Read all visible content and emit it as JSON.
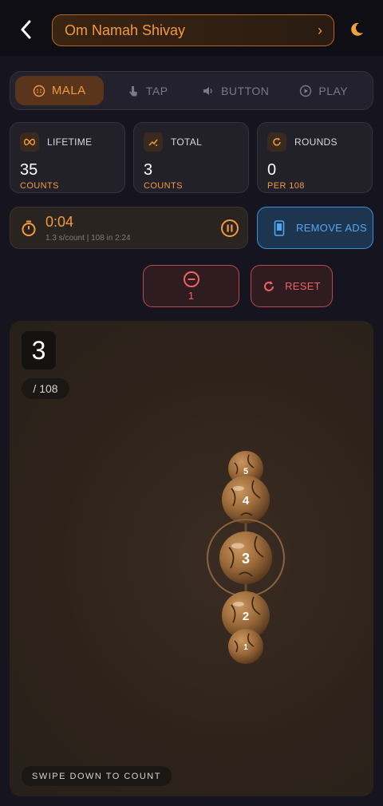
{
  "header": {
    "mantra": "Om Namah Shivay"
  },
  "modes": [
    {
      "label": "MALA",
      "icon": "mala-icon",
      "active": true
    },
    {
      "label": "TAP",
      "icon": "tap-icon",
      "active": false
    },
    {
      "label": "BUTTON",
      "icon": "speaker-icon",
      "active": false
    },
    {
      "label": "PLAY",
      "icon": "play-icon",
      "active": false
    }
  ],
  "stats": {
    "lifetime": {
      "label": "LIFETIME",
      "value": "35",
      "sub": "COUNTS"
    },
    "total": {
      "label": "TOTAL",
      "value": "3",
      "sub": "COUNTS"
    },
    "rounds": {
      "label": "ROUNDS",
      "value": "0",
      "sub": "PER 108"
    }
  },
  "timer": {
    "time": "0:04",
    "rate": "1.3 s/count  |  108 in 2:24"
  },
  "remove_ads": "REMOVE ADS",
  "controls": {
    "decrement_count": "1",
    "reset_label": "RESET"
  },
  "counter": {
    "current": "3",
    "target": "/ 108",
    "hint": "SWIPE DOWN TO COUNT"
  },
  "beads": {
    "labels": [
      "5",
      "4",
      "3",
      "2",
      "1"
    ]
  },
  "colors": {
    "accent": "#f29a3e",
    "danger": "#f06262",
    "info": "#53a6ee",
    "background": "#16141f"
  }
}
